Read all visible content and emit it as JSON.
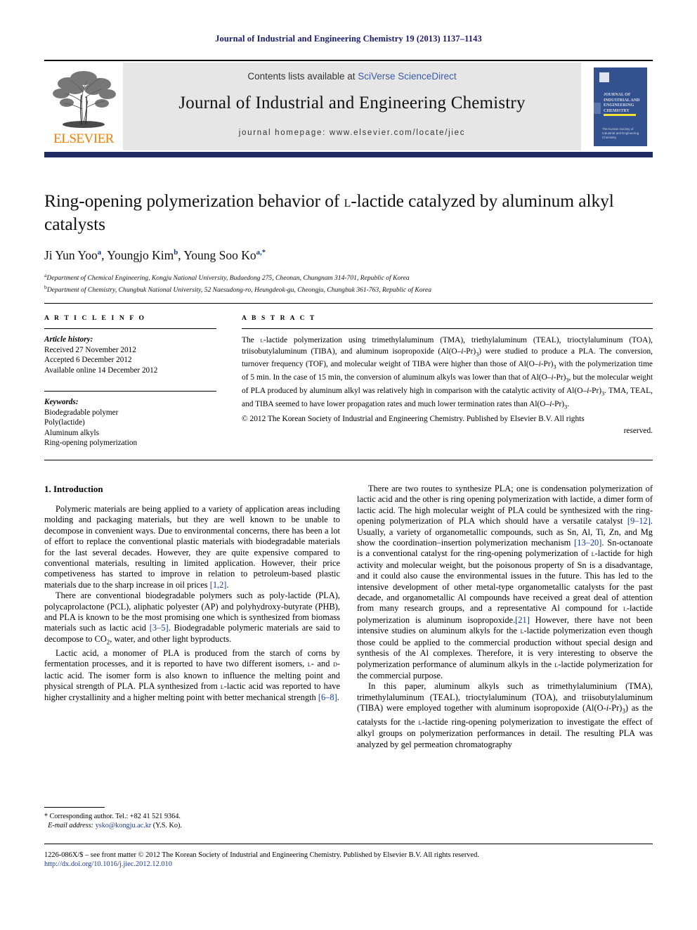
{
  "running_head": "Journal of Industrial and Engineering Chemistry 19 (2013) 1137–1143",
  "masthead": {
    "contents_prefix": "Contents lists available at ",
    "contents_link": "SciVerse ScienceDirect",
    "journal_title": "Journal of Industrial and Engineering Chemistry",
    "homepage": "journal homepage: www.elsevier.com/locate/jiec",
    "publisher_wordmark": "ELSEVIER",
    "cover": {
      "title_lines": "JOURNAL OF INDUSTRIAL AND ENGINEERING CHEMISTRY",
      "footer_text": "The Korean Society of Industrial and Engineering Chemistry"
    }
  },
  "article": {
    "title_part1": "Ring-opening polymerization behavior of ",
    "title_smallcap": "l",
    "title_part2": "-lactide catalyzed by aluminum alkyl catalysts",
    "authors_html": "Ji Yun Yoo a, Youngjo Kim b, Young Soo Ko a,*",
    "authors": [
      {
        "name": "Ji Yun Yoo",
        "marks": "a"
      },
      {
        "name": "Youngjo Kim",
        "marks": "b"
      },
      {
        "name": "Young Soo Ko",
        "marks": "a,*"
      }
    ],
    "affiliations": [
      {
        "mark": "a",
        "text": "Department of Chemical Engineering, Kongju National University, Budaedong 275, Cheonan, Chungnam 314-701, Republic of Korea"
      },
      {
        "mark": "b",
        "text": "Department of Chemistry, Chungbuk National University, 52 Naesudong-ro, Heungdeok-gu, Cheongju, Chungbuk 361-763, Republic of Korea"
      }
    ]
  },
  "article_info": {
    "label": "A R T I C L E  I N F O",
    "history_head": "Article history:",
    "history": [
      "Received 27 November 2012",
      "Accepted 6 December 2012",
      "Available online 14 December 2012"
    ],
    "keywords_head": "Keywords:",
    "keywords": [
      "Biodegradable polymer",
      "Poly(lactide)",
      "Aluminum alkyls",
      "Ring-opening polymerization"
    ]
  },
  "abstract": {
    "label": "A B S T R A C T",
    "text": "The l-lactide polymerization using trimethylaluminum (TMA), triethylaluminum (TEAL), trioctylaluminum (TOA), triisobutylaluminum (TIBA), and aluminum isopropoxide (Al(O–i-Pr)3) were studied to produce a PLA. The conversion, turnover frequency (TOF), and molecular weight of TIBA were higher than those of Al(O–i-Pr)3 with the polymerization time of 5 min. In the case of 15 min, the conversion of aluminum alkyls was lower than that of Al(O–i-Pr)3, but the molecular weight of PLA produced by aluminum alkyl was relatively high in comparison with the catalytic activity of Al(O–i-Pr)3. TMA, TEAL, and TIBA seemed to have lower propagation rates and much lower termination rates than Al(O–i-Pr)3.",
    "copyright": "© 2012 The Korean Society of Industrial and Engineering Chemistry. Published by Elsevier B.V. All rights",
    "copyright_tail": "reserved."
  },
  "body": {
    "section1_heading": "1.  Introduction",
    "left_paragraphs": [
      "Polymeric materials are being applied to a variety of application areas including molding and packaging materials, but they are well known to be unable to decompose in convenient ways. Due to environmental concerns, there has been a lot of effort to replace the conventional plastic materials with biodegradable materials for the last several decades. However, they are quite expensive compared to conventional materials, resulting in limited application. However, their price competiveness has started to improve in relation to petroleum-based plastic materials due to the sharp increase in oil prices [1,2].",
      "There are conventional biodegradable polymers such as poly-lactide (PLA), polycaprolactone (PCL), aliphatic polyester (AP) and polyhydroxy-butyrate (PHB), and PLA is known to be the most promising one which is synthesized from biomass materials such as lactic acid [3–5]. Biodegradable polymeric materials are said to decompose to CO2, water, and other light byproducts.",
      "Lactic acid, a monomer of PLA is produced from the starch of corns by fermentation processes, and it is reported to have two different isomers, l- and d-lactic acid. The isomer form is also known to influence the melting point and physical strength of PLA. PLA synthesized from l-lactic acid was reported to have higher crystallinity and a higher melting point with better mechanical strength [6–8]."
    ],
    "right_paragraphs": [
      "There are two routes to synthesize PLA; one is condensation polymerization of lactic acid and the other is ring opening polymerization with lactide, a dimer form of lactic acid. The high molecular weight of PLA could be synthesized with the ring-opening polymerization of PLA which should have a versatile catalyst [9–12]. Usually, a variety of organometallic compounds, such as Sn, Al, Ti, Zn, and Mg show the coordination–insertion polymerization mechanism [13–20]. Sn-octanoate is a conventional catalyst for the ring-opening polymerization of l-lactide for high activity and molecular weight, but the poisonous property of Sn is a disadvantage, and it could also cause the environmental issues in the future. This has led to the intensive development of other metal-type organometallic catalysts for the past decade, and organometallic Al compounds have received a great deal of attention from many research groups, and a representative Al compound for l-lactide polymerization is aluminum isopropoxide.[21] However, there have not been intensive studies on aluminum alkyls for the l-lactide polymerization even though those could be applied to the commercial production without special design and synthesis of the Al complexes. Therefore, it is very interesting to observe the polymerization performance of aluminum alkyls in the l-lactide polymerization for the commercial purpose.",
      "In this paper, aluminum alkyls such as trimethylaluminium (TMA), trimethylaluminum (TEAL), trioctylaluminum (TOA), and triisobutylaluminum (TIBA) were employed together with aluminum isopropoxide (Al(O-i-Pr)3) as the catalysts for the l-lactide ring-opening polymerization to investigate the effect of alkyl groups on polymerization performances in detail. The resulting PLA was analyzed by gel permeation chromatography"
    ]
  },
  "footnote": {
    "corresponding": "* Corresponding author. Tel.: +82 41 521 9364.",
    "email_label": "E-mail address:",
    "email": "ysko@kongju.ac.kr",
    "email_suffix": "(Y.S. Ko)."
  },
  "footer": {
    "issn_line": "1226-086X/$ – see front matter © 2012 The Korean Society of Industrial and Engineering Chemistry. Published by Elsevier B.V. All rights reserved.",
    "doi": "http://dx.doi.org/10.1016/j.jiec.2012.12.010"
  },
  "colors": {
    "link_blue": "#1a3a8f",
    "running_head_blue": "#1a1a6e",
    "elsevier_orange": "#f08000",
    "cover_blue": "#33508f",
    "cover_accent": "#f2e23a",
    "masthead_band": "#e6e6e6"
  }
}
